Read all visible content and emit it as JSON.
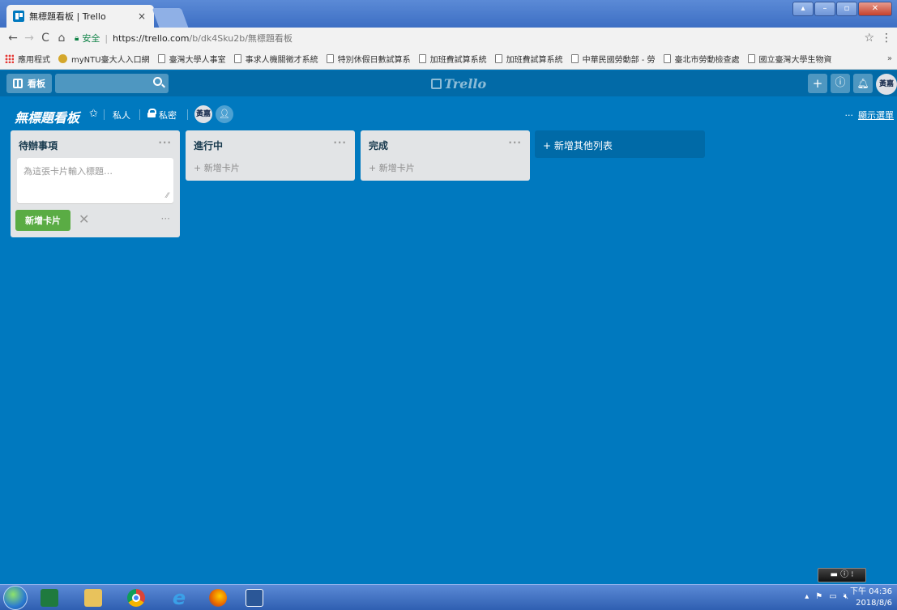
{
  "browser": {
    "tab_title": "無標題看板 | Trello",
    "tab_close": "×",
    "secure_label": "安全",
    "url_host": "https://trello.com",
    "url_path": "/b/dk4Sku2b/無標題看板",
    "bookmarks": [
      "應用程式",
      "myNTU臺大人入口網",
      "臺灣大學人事室",
      "事求人機關徵才系統",
      "特別休假日數試算系",
      "加班費試算系統",
      "加班費試算系統",
      "中華民國勞動部 - 勞",
      "臺北市勞動檢查處",
      "國立臺灣大學生物資"
    ],
    "bookmarks_more": "»"
  },
  "trello": {
    "boards_label": "看板",
    "logo_text": "Trello",
    "avatar_text": "黃嘉"
  },
  "board": {
    "title": "無標題看板",
    "team": "私人",
    "visibility": "私密",
    "member_avatar": "黃嘉",
    "show_menu": "顯示選單"
  },
  "lists": [
    {
      "title": "待辦事項",
      "composer_placeholder": "為這張卡片輸入標題…",
      "add_button": "新增卡片"
    },
    {
      "title": "進行中",
      "add_card": "+ 新增卡片"
    },
    {
      "title": "完成",
      "add_card": "+ 新增卡片"
    }
  ],
  "add_list_label": "+ 新增其他列表",
  "taskbar": {
    "time": "下午 04:36",
    "date": "2018/8/6"
  },
  "colors": {
    "board_bg": "#0079bf",
    "header_bg": "#026aa7",
    "add_button": "#5aac44"
  }
}
